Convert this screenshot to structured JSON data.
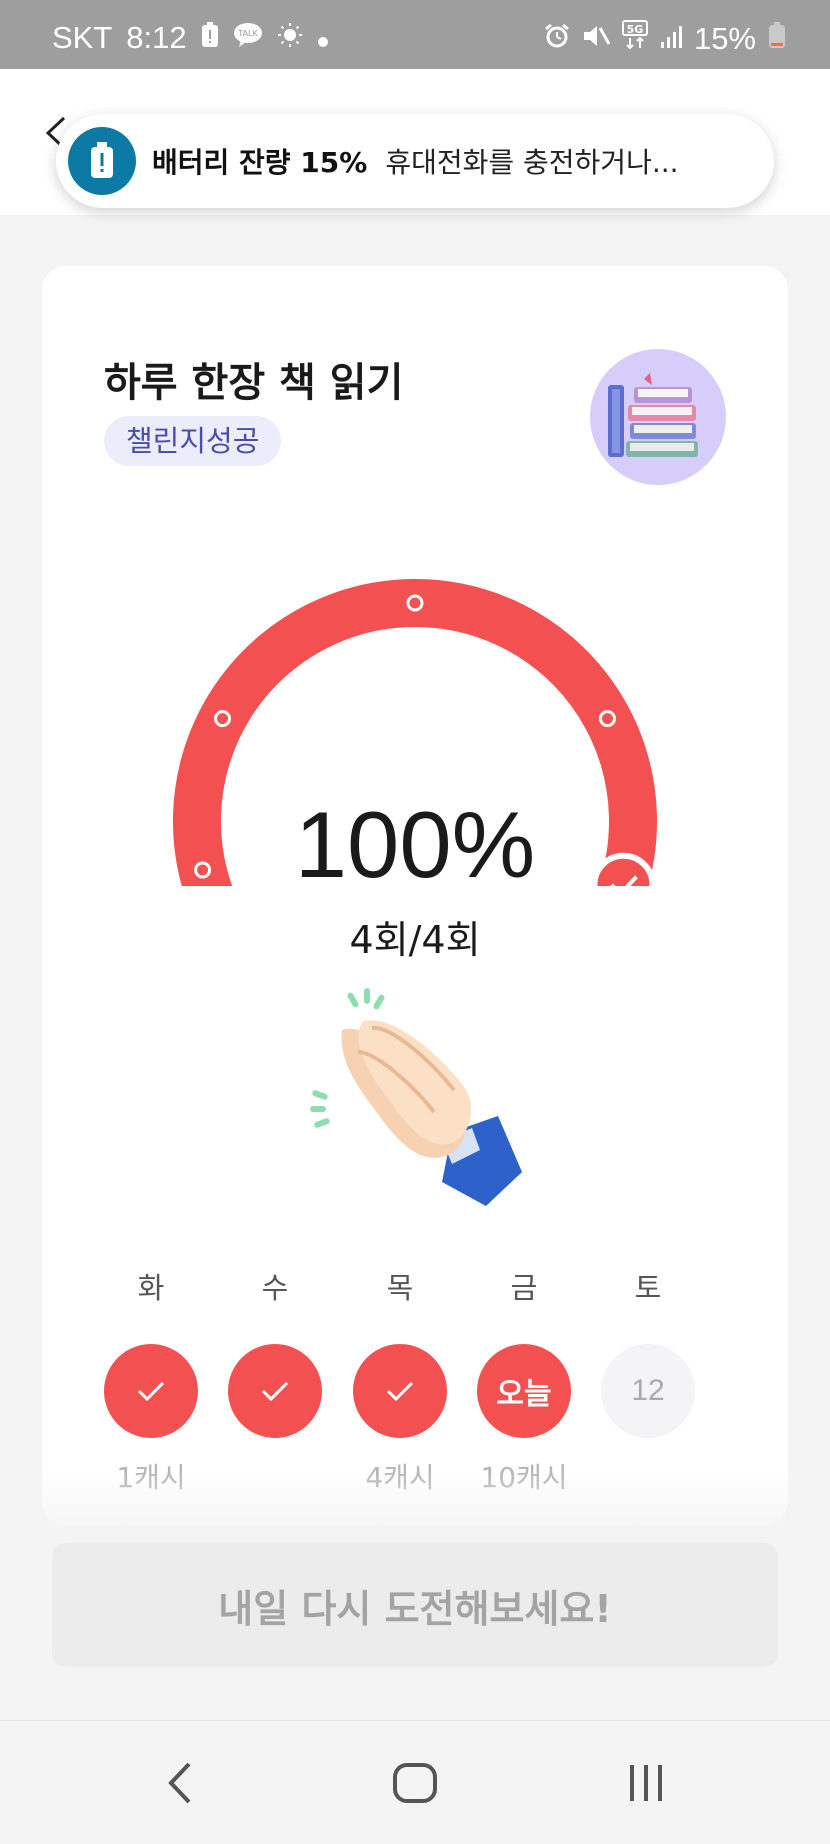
{
  "status_bar": {
    "carrier": "SKT",
    "time": "8:12",
    "network": "5G",
    "battery": "15%",
    "icons_left": [
      "battery-alert-icon",
      "kakaotalk-icon",
      "brightness-icon",
      "dot-icon"
    ],
    "icons_right": [
      "alarm-icon",
      "mute-icon",
      "network-5g-icon",
      "signal-icon",
      "battery-low-icon"
    ],
    "kakao_label": "TALK"
  },
  "toast": {
    "title": "배터리 잔량 15%",
    "message": "휴대전화를 충전하거나..."
  },
  "challenge": {
    "title": "하루 한장 책 읽기",
    "badge": "챌린지성공",
    "progress_percent": 100,
    "progress_text": "100%",
    "count_text": "4회/4회",
    "completed": 4,
    "total": 4
  },
  "days": [
    {
      "label": "화",
      "state": "done",
      "text": "",
      "reward": "1캐시"
    },
    {
      "label": "수",
      "state": "done",
      "text": "",
      "reward": ""
    },
    {
      "label": "목",
      "state": "done",
      "text": "",
      "reward": "4캐시"
    },
    {
      "label": "금",
      "state": "today",
      "text": "오늘",
      "reward": "10캐시"
    },
    {
      "label": "토",
      "state": "future",
      "text": "12",
      "reward": ""
    }
  ],
  "cta": {
    "label": "내일 다시 도전해보세요!"
  },
  "colors": {
    "accent": "#f35151",
    "badge_bg": "#ecedfb",
    "badge_text": "#4a4ea6",
    "toast_icon": "#0d7aa6"
  }
}
